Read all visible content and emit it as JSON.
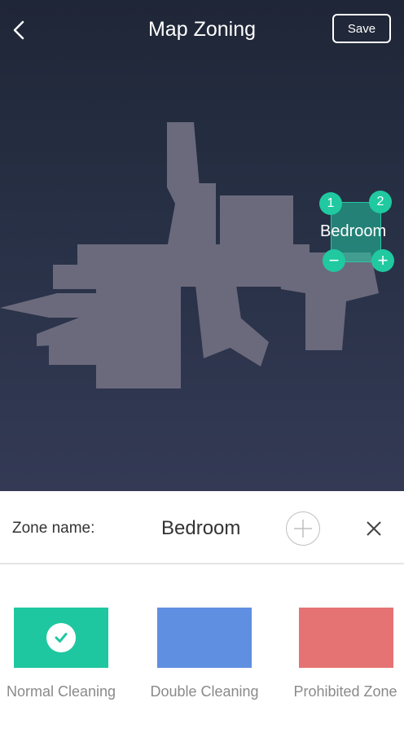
{
  "header": {
    "title": "Map Zoning",
    "save_label": "Save"
  },
  "icons": {
    "back": "chevron-left-icon",
    "add": "plus-circle-icon",
    "close": "close-icon",
    "check": "check-icon"
  },
  "zone": {
    "map_label": "Bedroom",
    "handle_1": "1",
    "handle_2": "2",
    "shrink": "−",
    "expand": "+"
  },
  "panel": {
    "zone_name_label": "Zone name:",
    "zone_name_value": "Bedroom",
    "types": [
      {
        "label": "Normal Cleaning",
        "color": "#1fc7a0",
        "selected": true
      },
      {
        "label": "Double Cleaning",
        "color": "#5f8fe0",
        "selected": false
      },
      {
        "label": "Prohibited Zone",
        "color": "#e57373",
        "selected": false
      }
    ]
  },
  "colors": {
    "accent": "#20c9a0",
    "map_bg": "#273045",
    "map_floor": "#6b6a7d"
  }
}
